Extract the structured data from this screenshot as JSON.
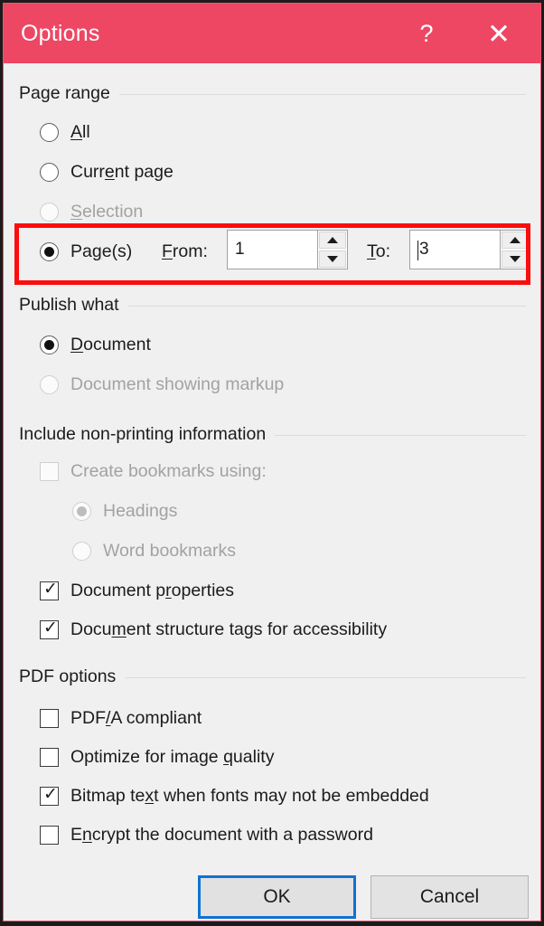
{
  "window": {
    "title": "Options",
    "help_icon": "question-mark-icon",
    "close_icon": "close-icon",
    "titlebar_color": "#ED4764",
    "body_color": "#F0F0F0"
  },
  "page_range": {
    "header": "Page range",
    "options": [
      {
        "label": "All",
        "accel": "A",
        "checked": false,
        "enabled": true
      },
      {
        "label": "Current page",
        "accel": "e",
        "checked": false,
        "enabled": true
      },
      {
        "label": "Selection",
        "accel": "S",
        "checked": false,
        "enabled": false
      },
      {
        "label": "Page(s)",
        "accel": "g",
        "checked": true,
        "enabled": true
      }
    ],
    "from": {
      "label": "From:",
      "accel": "F",
      "value": "1"
    },
    "to": {
      "label": "To:",
      "accel": "T",
      "value": "3",
      "has_caret": true
    }
  },
  "publish_what": {
    "header": "Publish what",
    "options": [
      {
        "label": "Document",
        "accel": "D",
        "checked": true,
        "enabled": true
      },
      {
        "label": "Document showing markup",
        "accel": "",
        "checked": false,
        "enabled": false
      }
    ]
  },
  "include_non_printing": {
    "header": "Include non-printing information",
    "checkboxes": [
      {
        "label": "Create bookmarks using:",
        "accel": "",
        "checked": false,
        "enabled": false
      }
    ],
    "radios": [
      {
        "label": "Headings",
        "accel": "",
        "checked": true,
        "enabled": false
      },
      {
        "label": "Word bookmarks",
        "accel": "",
        "checked": false,
        "enabled": false
      }
    ],
    "more_checkboxes": [
      {
        "label": "Document properties",
        "accel": "r",
        "checked": true,
        "enabled": true
      },
      {
        "label": "Document structure tags for accessibility",
        "accel": "m",
        "checked": true,
        "enabled": true
      }
    ]
  },
  "pdf_options": {
    "header": "PDF options",
    "checkboxes": [
      {
        "label": "PDF/A compliant",
        "accel": "/",
        "checked": false,
        "enabled": true
      },
      {
        "label": "Optimize for image quality",
        "accel": "q",
        "checked": false,
        "enabled": true
      },
      {
        "label": "Bitmap text when fonts may not be embedded",
        "accel": "x",
        "checked": true,
        "enabled": true
      },
      {
        "label": "Encrypt the document with a password",
        "accel": "n",
        "checked": false,
        "enabled": true
      }
    ]
  },
  "buttons": {
    "ok": "OK",
    "cancel": "Cancel"
  },
  "annotation": {
    "color": "#FC0D0D",
    "target": "page-range-pages-row"
  },
  "check_glyph": "✓"
}
